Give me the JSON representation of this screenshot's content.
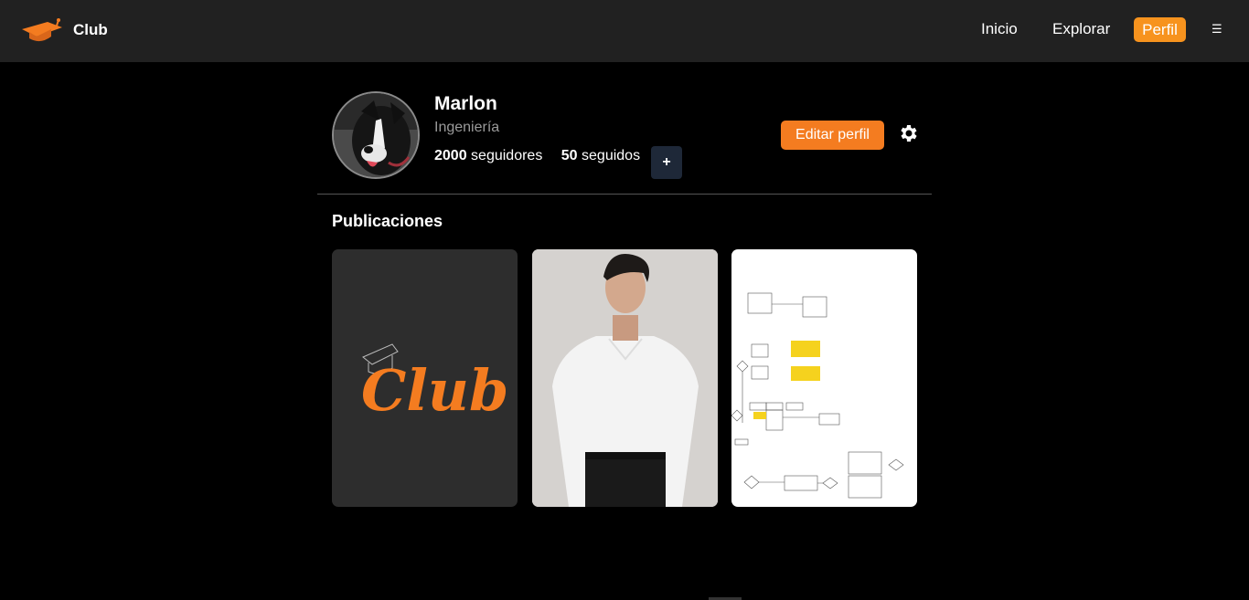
{
  "navbar": {
    "brand": "Club",
    "links": [
      "Inicio",
      "Explorar"
    ],
    "active_link": "Perfil",
    "menu_icon": "hamburger-icon",
    "menu_glyph": "☰"
  },
  "profile": {
    "name": "Marlon",
    "career": "Ingeniería",
    "followers_count": "2000",
    "followers_label": "seguidores",
    "following_count": "50",
    "following_label": "seguidos",
    "add_label": "+",
    "edit_label": "Editar perfil",
    "settings_icon": "gear-icon"
  },
  "posts": {
    "title": "Publicaciones",
    "items": [
      {
        "kind": "club-logo-image",
        "logo_text": "Club"
      },
      {
        "kind": "portrait-photo"
      },
      {
        "kind": "diagram-image"
      }
    ]
  },
  "colors": {
    "accent": "#f47c20",
    "navbar_bg": "#212121",
    "page_bg": "#000000",
    "plus_button_bg": "#1e2838"
  }
}
